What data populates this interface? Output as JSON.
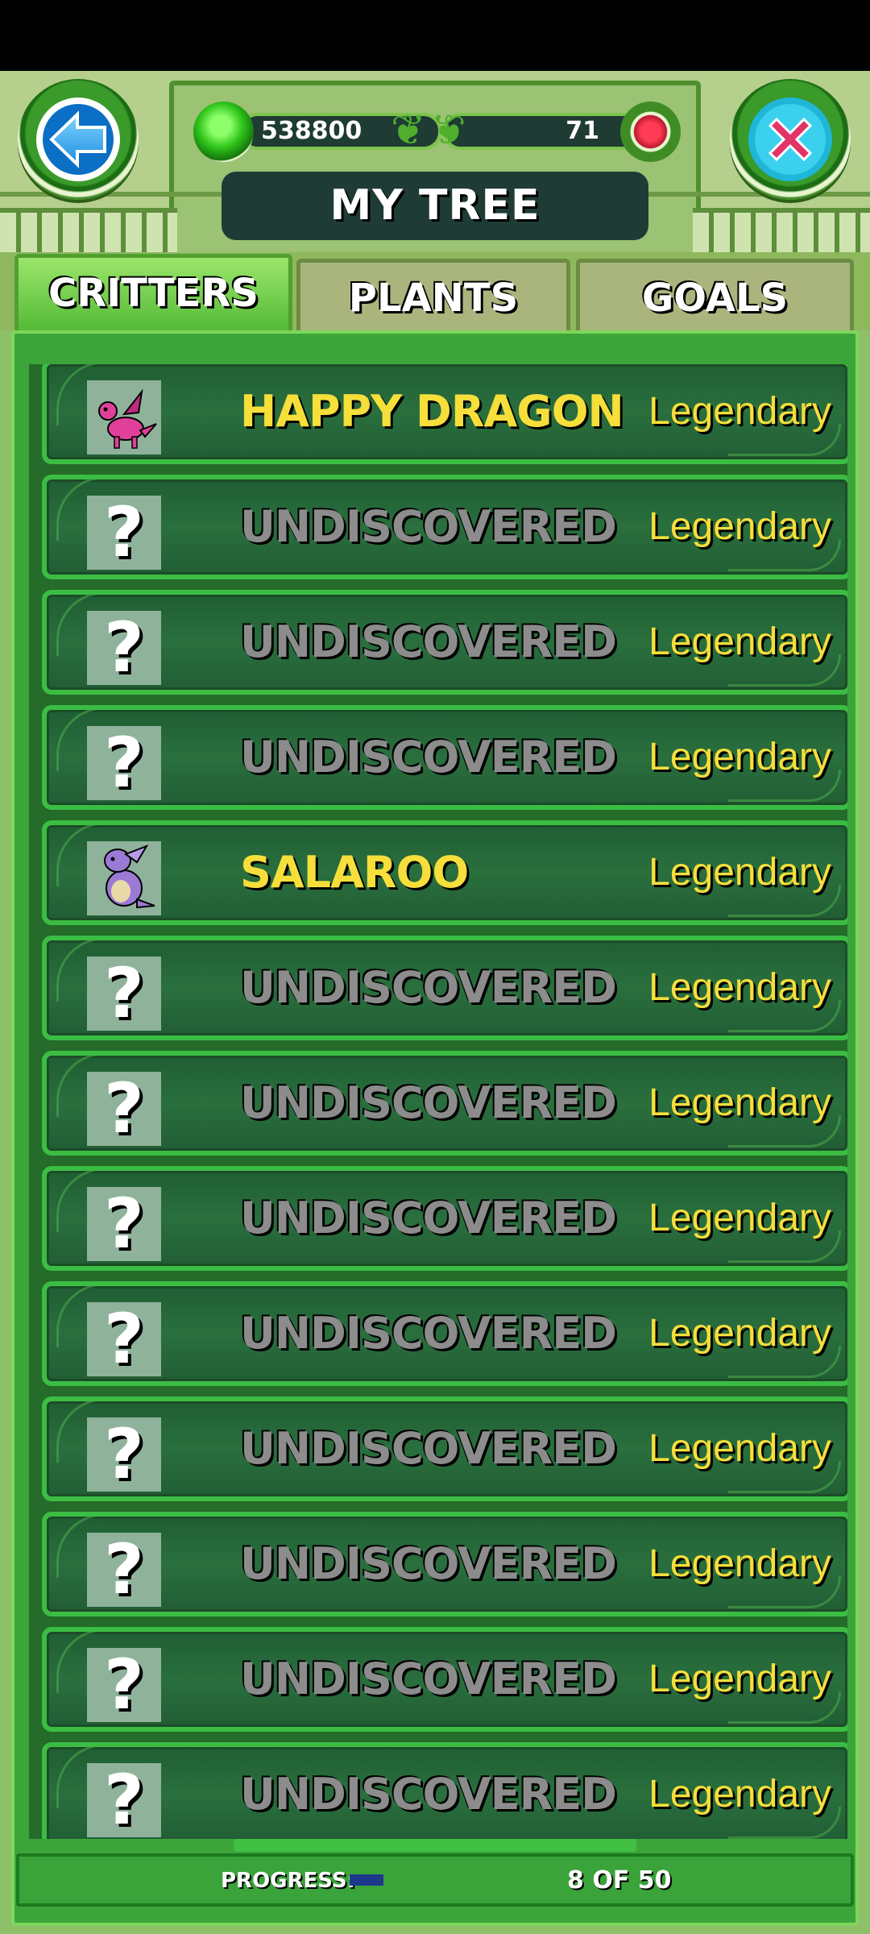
{
  "header": {
    "title": "MY TREE",
    "coins": "538800",
    "gems": "71"
  },
  "tabs": [
    {
      "label": "CRITTERS",
      "active": true
    },
    {
      "label": "PLANTS",
      "active": false
    },
    {
      "label": "GOALS",
      "active": false
    }
  ],
  "critters": [
    {
      "name": "HAPPY DRAGON",
      "rarity": "Legendary",
      "discovered": true,
      "icon": "pink-dragon-icon"
    },
    {
      "name": "UNDISCOVERED",
      "rarity": "Legendary",
      "discovered": false,
      "icon": "question-mark-icon"
    },
    {
      "name": "UNDISCOVERED",
      "rarity": "Legendary",
      "discovered": false,
      "icon": "question-mark-icon"
    },
    {
      "name": "UNDISCOVERED",
      "rarity": "Legendary",
      "discovered": false,
      "icon": "question-mark-icon"
    },
    {
      "name": "SALAROO",
      "rarity": "Legendary",
      "discovered": true,
      "icon": "purple-salaroo-icon"
    },
    {
      "name": "UNDISCOVERED",
      "rarity": "Legendary",
      "discovered": false,
      "icon": "question-mark-icon"
    },
    {
      "name": "UNDISCOVERED",
      "rarity": "Legendary",
      "discovered": false,
      "icon": "question-mark-icon"
    },
    {
      "name": "UNDISCOVERED",
      "rarity": "Legendary",
      "discovered": false,
      "icon": "question-mark-icon"
    },
    {
      "name": "UNDISCOVERED",
      "rarity": "Legendary",
      "discovered": false,
      "icon": "question-mark-icon"
    },
    {
      "name": "UNDISCOVERED",
      "rarity": "Legendary",
      "discovered": false,
      "icon": "question-mark-icon"
    },
    {
      "name": "UNDISCOVERED",
      "rarity": "Legendary",
      "discovered": false,
      "icon": "question-mark-icon"
    },
    {
      "name": "UNDISCOVERED",
      "rarity": "Legendary",
      "discovered": false,
      "icon": "question-mark-icon"
    },
    {
      "name": "UNDISCOVERED",
      "rarity": "Legendary",
      "discovered": false,
      "icon": "question-mark-icon"
    }
  ],
  "footer": {
    "progress_label": "PROGRESS:",
    "progress_count": "8 OF 50",
    "progress_fraction": 0.16
  },
  "colors": {
    "discovered_name": "#f6de3b",
    "undiscovered_name": "#8c8c8c",
    "row_border": "#3bbd44",
    "title_box": "#1f3b36"
  }
}
